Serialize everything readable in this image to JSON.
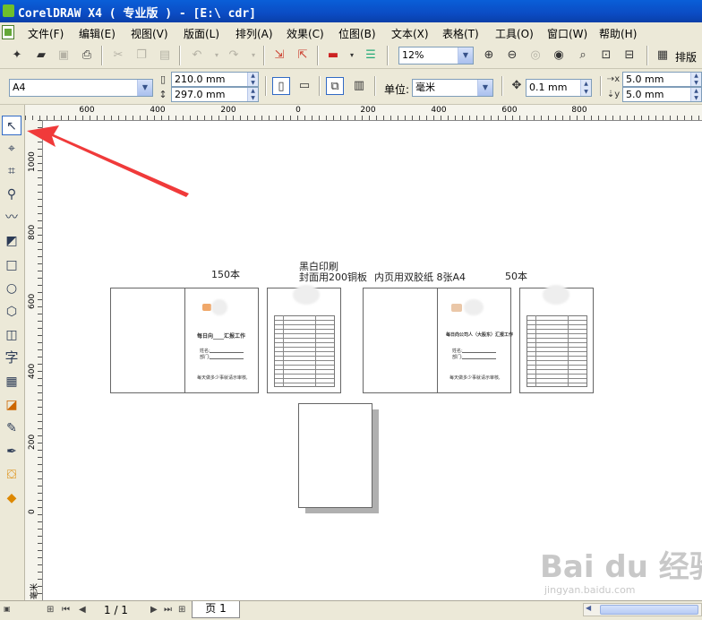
{
  "window": {
    "title": "CorelDRAW X4 ( 专业版 ) - [E:\\        cdr]"
  },
  "menu": [
    "文件(F)",
    "编辑(E)",
    "视图(V)",
    "版面(L)",
    "排列(A)",
    "效果(C)",
    "位图(B)",
    "文本(X)",
    "表格(T)",
    "工具(O)",
    "窗口(W)",
    "帮助(H)"
  ],
  "toolbar": {
    "zoom": "12%",
    "typeset_label": "排版"
  },
  "propbar": {
    "paper_size": "A4",
    "width": "210.0 mm",
    "height": "297.0 mm",
    "unit_label": "单位:",
    "unit": "毫米",
    "nudge": "0.1 mm",
    "dup_x": "5.0 mm",
    "dup_y": "5.0 mm"
  },
  "ruler": {
    "h": [
      "600",
      "400",
      "200",
      "0",
      "200",
      "400",
      "600",
      "800"
    ],
    "v": [
      "1000",
      "800",
      "600",
      "400",
      "200",
      "0"
    ],
    "unit": "毫米"
  },
  "canvas": {
    "label_150": "150本",
    "label_print_1": "黑白印刷",
    "label_print_2": "封面用200铜板",
    "label_inner": "内页用双胶纸 8张A4",
    "label_50": "50本",
    "cover_title_1": "每日向____汇报工作",
    "cover_title_2": "每日向公司人（大股东）汇报工作",
    "cover_field_a": "姓名:",
    "cover_field_b": "部门:",
    "cover_note_1": "每天做多少事就请示审核,",
    "cover_note_2": "每天做多少事就请示审核,"
  },
  "status": {
    "page_count": "1 / 1",
    "page_tab": "页 1"
  },
  "watermark": {
    "logo": "Bai du 经验",
    "url": "jingyan.baidu.com"
  },
  "colors": {
    "title_bar": "#0b4cc4",
    "arrow": "#f03a3a",
    "selection": "#316ac5"
  }
}
